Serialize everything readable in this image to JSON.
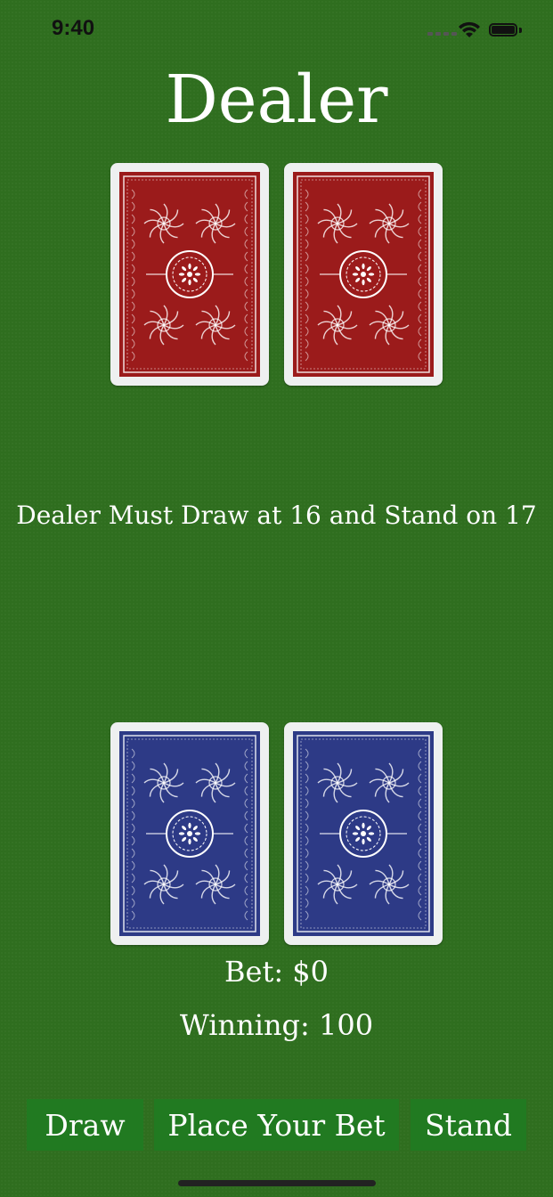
{
  "status_bar": {
    "time": "9:40"
  },
  "dealer": {
    "title": "Dealer",
    "cards": [
      {
        "face": "back",
        "color": "#9b1b1b"
      },
      {
        "face": "back",
        "color": "#9b1b1b"
      }
    ]
  },
  "rule_text": "Dealer Must Draw at 16 and Stand on 17",
  "player": {
    "cards": [
      {
        "face": "back",
        "color": "#2d3a86"
      },
      {
        "face": "back",
        "color": "#2d3a86"
      }
    ],
    "bet": "Bet: $0",
    "winning": "Winning: 100"
  },
  "buttons": {
    "draw": "Draw",
    "place_bet": "Place Your Bet",
    "stand": "Stand"
  },
  "colors": {
    "felt": "#2f6e1f",
    "button": "#217a21",
    "dealer_card": "#9b1b1b",
    "player_card": "#2d3a86"
  }
}
